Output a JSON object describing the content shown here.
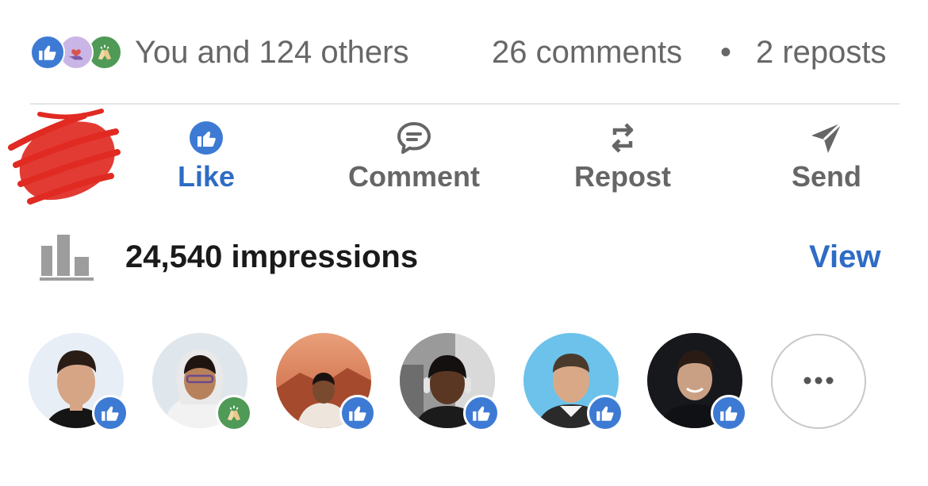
{
  "reactions": {
    "types": [
      "like-icon",
      "love-icon",
      "celebrate-icon"
    ],
    "summary": "You and 124 others"
  },
  "engagement": {
    "comments": "26 comments",
    "separator": "•",
    "reposts": "2 reposts"
  },
  "actions": [
    {
      "label": "Like",
      "icon": "thumbs-up-icon",
      "active": true
    },
    {
      "label": "Comment",
      "icon": "comment-icon",
      "active": false
    },
    {
      "label": "Repost",
      "icon": "repost-icon",
      "active": false
    },
    {
      "label": "Send",
      "icon": "send-icon",
      "active": false
    }
  ],
  "impressions": {
    "label": "24,540 impressions",
    "link": "View",
    "icon": "bar-chart-icon"
  },
  "reactors": [
    {
      "reaction": "like"
    },
    {
      "reaction": "celebrate"
    },
    {
      "reaction": "like"
    },
    {
      "reaction": "like"
    },
    {
      "reaction": "like"
    },
    {
      "reaction": "like"
    }
  ],
  "more_button": {
    "icon": "more-icon"
  },
  "colors": {
    "accent_blue": "#2e6cc5",
    "like_blue": "#3d7ad4",
    "celebrate_green": "#4f9a56",
    "muted_text": "#676767",
    "scribble_red": "#e02a22"
  }
}
